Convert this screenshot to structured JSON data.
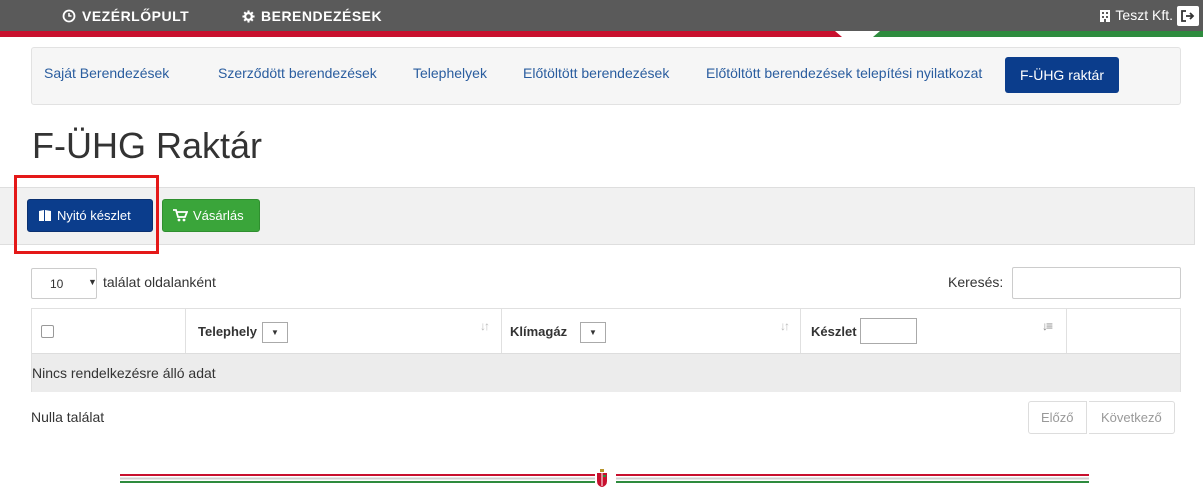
{
  "topbar": {
    "dashboard_label": "VEZÉRLŐPULT",
    "equipment_label": "BERENDEZÉSEK",
    "company": "Teszt Kft."
  },
  "subnav": {
    "items": [
      {
        "label": "Saját Berendezések"
      },
      {
        "label": "Szerződött berendezések"
      },
      {
        "label": "Telephelyek"
      },
      {
        "label": "Előtöltött berendezések"
      },
      {
        "label": "Előtöltött berendezések telepítési nyilatkozat"
      },
      {
        "label": "F-ÜHG raktár"
      }
    ]
  },
  "page": {
    "title": "F-ÜHG Raktár"
  },
  "toolbar": {
    "opening_stock_label": "Nyitó készlet",
    "purchase_label": "Vásárlás"
  },
  "table_controls": {
    "page_length": "10",
    "page_length_label": "találat oldalanként",
    "search_label": "Keresés:"
  },
  "table": {
    "columns": [
      {
        "label": ""
      },
      {
        "label": "Telephely"
      },
      {
        "label": "Klímagáz"
      },
      {
        "label": "Készlet"
      },
      {
        "label": ""
      }
    ],
    "empty_text": "Nincs rendelkezésre álló adat"
  },
  "footer": {
    "info": "Nulla találat",
    "prev_label": "Előző",
    "next_label": "Következő"
  },
  "colors": {
    "topbar": "#5a5a5a",
    "primary": "#0b3d8c",
    "success": "#3aa53a",
    "highlight": "#e41818",
    "link": "#2a5d9f"
  }
}
